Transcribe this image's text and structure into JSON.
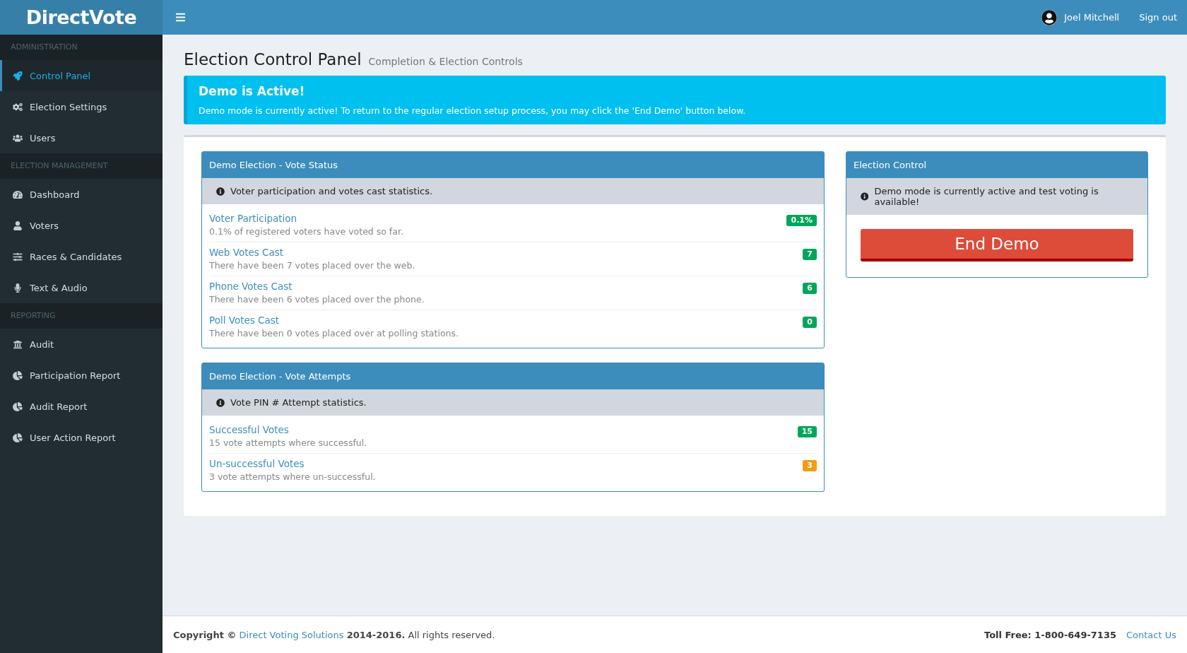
{
  "header": {
    "logo": "DirectVote",
    "user_name": "Joel Mitchell",
    "sign_out": "Sign out"
  },
  "sidebar": {
    "sections": [
      {
        "title": "ADMINISTRATION",
        "items": [
          {
            "label": "Control Panel",
            "selected": true
          },
          {
            "label": "Election Settings",
            "selected": false
          },
          {
            "label": "Users",
            "selected": false
          }
        ]
      },
      {
        "title": "ELECTION MANAGEMENT",
        "items": [
          {
            "label": "Dashboard",
            "selected": false
          },
          {
            "label": "Voters",
            "selected": false
          },
          {
            "label": "Races & Candidates",
            "selected": false
          },
          {
            "label": "Text & Audio",
            "selected": false
          }
        ]
      },
      {
        "title": "REPORTING",
        "items": [
          {
            "label": "Audit",
            "selected": false
          },
          {
            "label": "Participation Report",
            "selected": false
          },
          {
            "label": "Audit Report",
            "selected": false
          },
          {
            "label": "User Action Report",
            "selected": false
          }
        ]
      }
    ]
  },
  "page": {
    "title": "Election Control Panel",
    "subtitle": "Completion & Election Controls"
  },
  "alert": {
    "title": "Demo is Active!",
    "message": "Demo mode is currently active! To return to the regular election setup process, you may click the 'End Demo' button below."
  },
  "panels": [
    {
      "title": "Demo Election - Vote Status",
      "info": "Voter participation and votes cast statistics.",
      "rows": [
        {
          "title": "Voter Participation",
          "description": "0.1% of registered voters have voted so far.",
          "badge": "0.1%",
          "color": "#00a65a"
        },
        {
          "title": "Web Votes Cast",
          "description": "There have been 7 votes placed over the web.",
          "badge": "7",
          "color": "#00a65a"
        },
        {
          "title": "Phone Votes Cast",
          "description": "There have been 6 votes placed over the phone.",
          "badge": "6",
          "color": "#00a65a"
        },
        {
          "title": "Poll Votes Cast",
          "description": "There have been 0 votes placed over at polling stations.",
          "badge": "0",
          "color": "#00a65a"
        }
      ]
    },
    {
      "title": "Demo Election - Vote Attempts",
      "info": "Vote PIN # Attempt statistics.",
      "rows": [
        {
          "title": "Successful Votes",
          "description": "15 vote attempts where successful.",
          "badge": "15",
          "color": "#00a65a"
        },
        {
          "title": "Un-successful Votes",
          "description": "3 vote attempts where un-successful.",
          "badge": "3",
          "color": "#f39c12"
        }
      ]
    }
  ],
  "control": {
    "title": "Election Control",
    "info": "Demo mode is currently active and test voting is available!",
    "button": "End Demo"
  },
  "footer": {
    "copyright_prefix": "Copyright ©",
    "copyright_link": "Direct Voting Solutions",
    "copyright_suffix": "**2014-2016.** All rights reserved.",
    "toll_free": "Toll Free: 1-800-649-7135",
    "contact": "Contact Us"
  }
}
